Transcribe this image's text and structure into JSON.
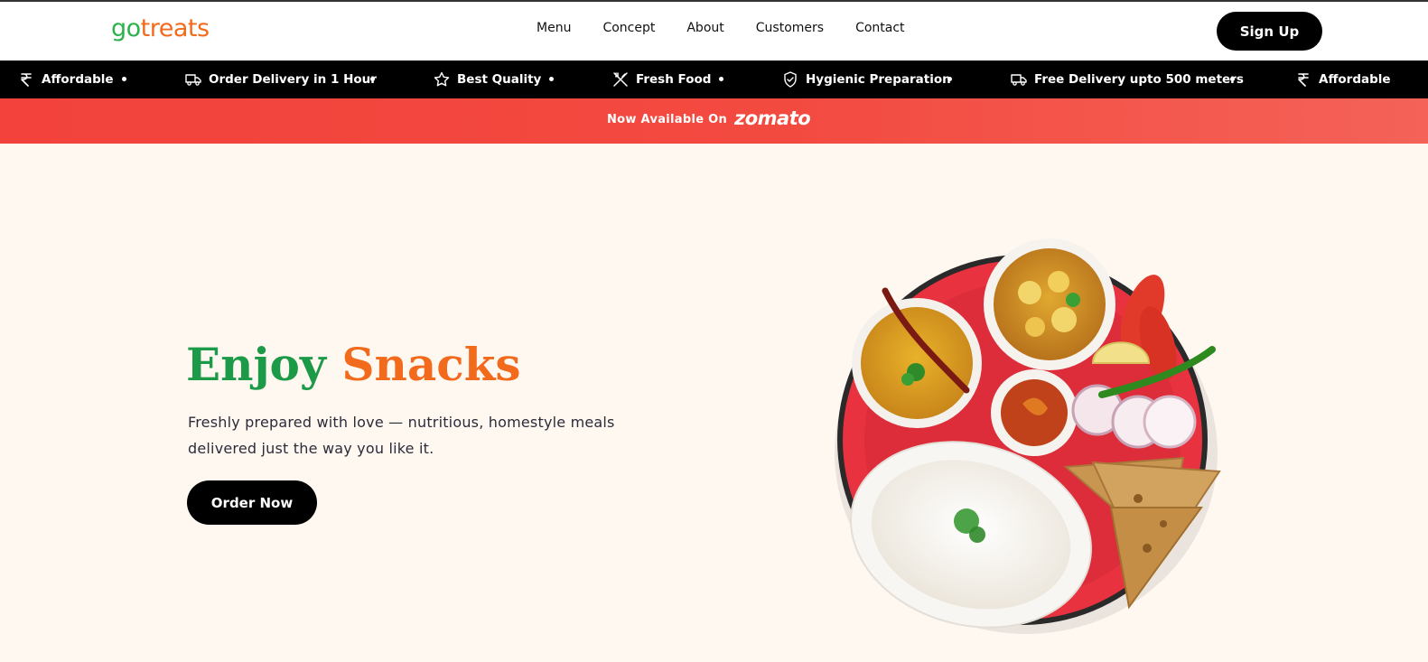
{
  "brand": {
    "logo_part1": "go",
    "logo_part2": "treats"
  },
  "nav": {
    "items": [
      "Menu",
      "Concept",
      "About",
      "Customers",
      "Contact"
    ]
  },
  "header": {
    "signup_label": "Sign Up"
  },
  "ticker": {
    "items": [
      {
        "label": "Affordable",
        "icon": "rupee-icon"
      },
      {
        "label": "Order Delivery in 1 Hour",
        "icon": "truck-icon"
      },
      {
        "label": "Best Quality",
        "icon": "star-icon"
      },
      {
        "label": "Fresh Food",
        "icon": "utensils-icon"
      },
      {
        "label": "Hygienic Preparation",
        "icon": "shield-icon"
      },
      {
        "label": "Free Delivery upto 500 meters",
        "icon": "truck-icon"
      },
      {
        "label": "Affordable",
        "icon": "rupee-icon"
      }
    ]
  },
  "banner": {
    "text": "Now Available On",
    "partner": "zomato"
  },
  "hero": {
    "title_part1": "Enjoy",
    "title_part2": "Snacks",
    "subtitle": "Freshly prepared with love — nutritious, homestyle meals delivered just the way you like it.",
    "cta_label": "Order Now"
  },
  "colors": {
    "brand_green": "#2bb24c",
    "brand_orange": "#f26a1b",
    "banner_red": "#f2423b",
    "hero_bg": "#fff8f1",
    "button_black": "#000000"
  }
}
